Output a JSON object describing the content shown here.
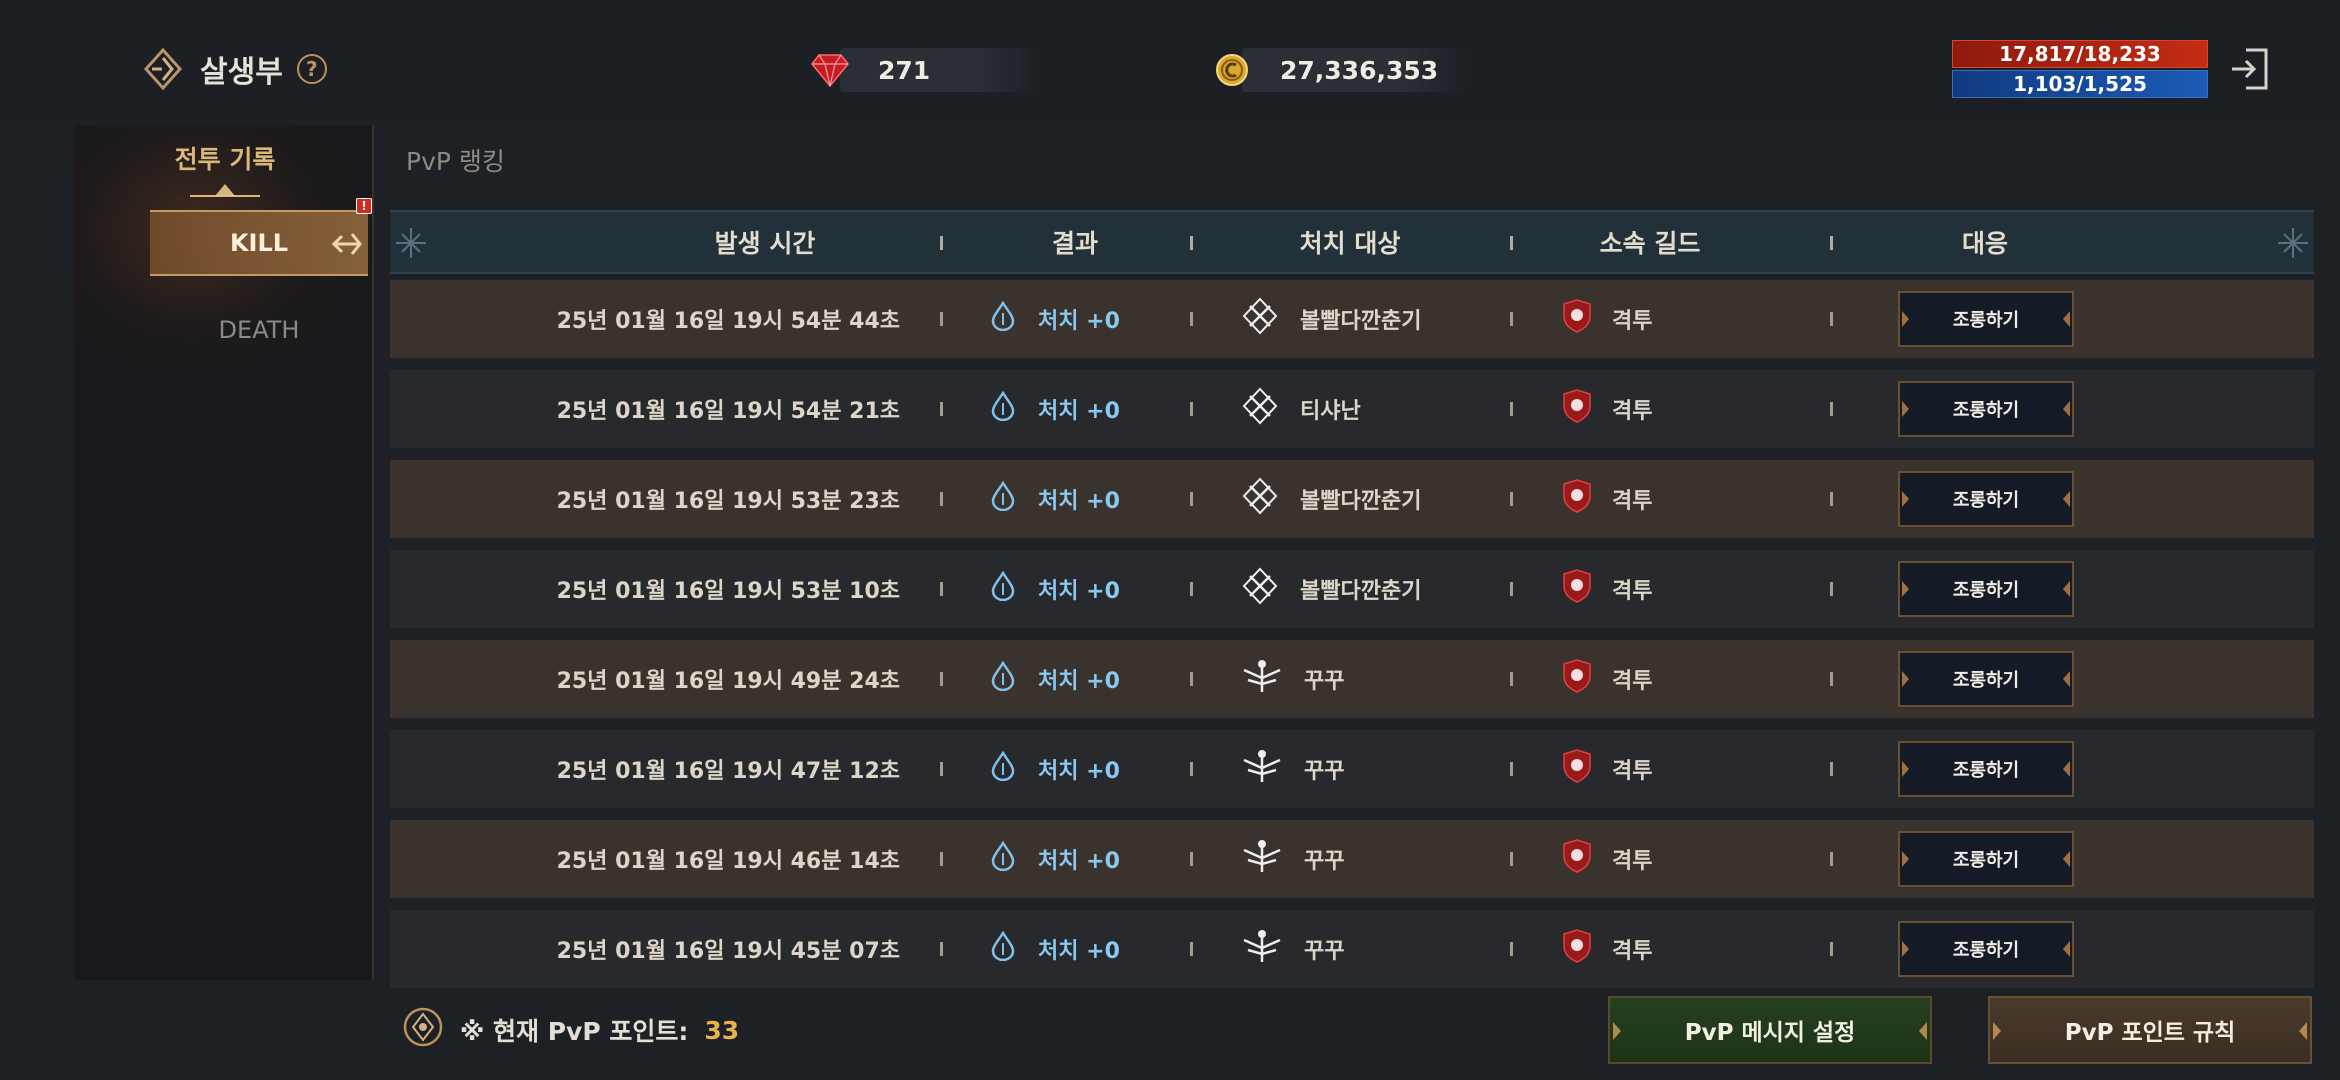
{
  "header": {
    "title": "살생부",
    "help_symbol": "?",
    "gem_count": "271",
    "gold_count": "27,336,353",
    "hp_text": "17,817/18,233",
    "mp_text": "1,103/1,525"
  },
  "sidebar": {
    "section_tab": "전투 기록",
    "items": [
      {
        "label": "KILL",
        "selected": true,
        "alert": "!"
      },
      {
        "label": "DEATH",
        "selected": false
      }
    ]
  },
  "tabs": {
    "pvp_ranking": "PvP 랭킹"
  },
  "table": {
    "headers": [
      "발생 시간",
      "결과",
      "처치 대상",
      "소속 길드",
      "대응"
    ],
    "rows": [
      {
        "time": "25년 01월 16일 19시 54분 44초",
        "result": "처치 +0",
        "target": "볼빨다깐춘기",
        "target_icon": "crossed-swords-emblem-icon",
        "guild": "격투",
        "action": "조롱하기"
      },
      {
        "time": "25년 01월 16일 19시 54분 21초",
        "result": "처치 +0",
        "target": "티샤난",
        "target_icon": "crossed-swords-emblem-icon",
        "guild": "격투",
        "action": "조롱하기"
      },
      {
        "time": "25년 01월 16일 19시 53분 23초",
        "result": "처치 +0",
        "target": "볼빨다깐춘기",
        "target_icon": "crossed-swords-emblem-icon",
        "guild": "격투",
        "action": "조롱하기"
      },
      {
        "time": "25년 01월 16일 19시 53분 10초",
        "result": "처치 +0",
        "target": "볼빨다깐춘기",
        "target_icon": "crossed-swords-emblem-icon",
        "guild": "격투",
        "action": "조롱하기"
      },
      {
        "time": "25년 01월 16일 19시 49분 24초",
        "result": "처치 +0",
        "target": "꾸꾸",
        "target_icon": "winged-crest-icon",
        "guild": "격투",
        "action": "조롱하기"
      },
      {
        "time": "25년 01월 16일 19시 47분 12초",
        "result": "처치 +0",
        "target": "꾸꾸",
        "target_icon": "winged-crest-icon",
        "guild": "격투",
        "action": "조롱하기"
      },
      {
        "time": "25년 01월 16일 19시 46분 14초",
        "result": "처치 +0",
        "target": "꾸꾸",
        "target_icon": "winged-crest-icon",
        "guild": "격투",
        "action": "조롱하기"
      },
      {
        "time": "25년 01월 16일 19시 45분 07초",
        "result": "처치 +0",
        "target": "꾸꾸",
        "target_icon": "winged-crest-icon",
        "guild": "격투",
        "action": "조롱하기"
      }
    ]
  },
  "footer": {
    "points_label": "※ 현재 PvP 포인트:",
    "points_value": "33",
    "message_button": "PvP 메시지 설정",
    "rules_button": "PvP 포인트 규칙"
  },
  "colors": {
    "accent_gold": "#d9b87a",
    "points_orange": "#e8b24a",
    "result_blue": "#8ac8ef",
    "hp_red": "#c42c14",
    "mp_blue": "#1c5bb6"
  }
}
